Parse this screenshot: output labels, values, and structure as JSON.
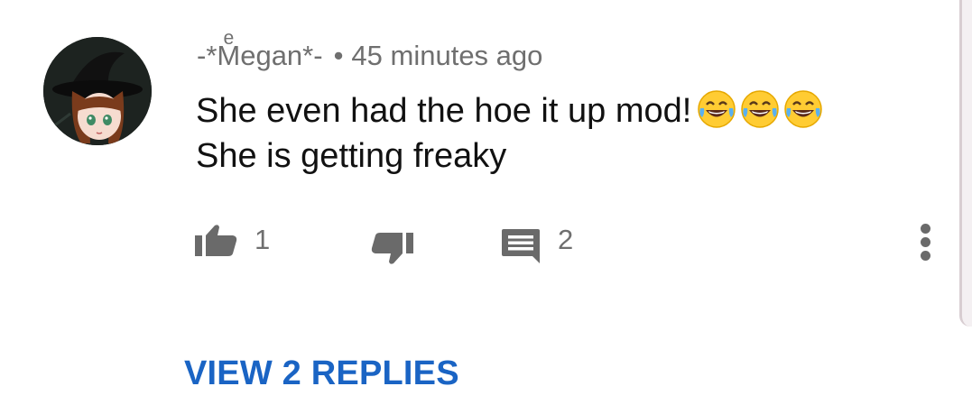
{
  "comment": {
    "author": "-*Mͤegan*-",
    "separator": "•",
    "timestamp": "45 minutes ago",
    "text_line_1": "She even had the hoe it up mod!",
    "text_line_2": "She is getting freaky",
    "emojis": [
      "face-with-tears-of-joy",
      "face-with-tears-of-joy",
      "face-with-tears-of-joy"
    ],
    "like_count": "1",
    "reply_count": "2",
    "view_replies_label": "VIEW 2 REPLIES"
  },
  "icons": {
    "like": "thumbs-up-icon",
    "dislike": "thumbs-down-icon",
    "reply": "comment-icon",
    "more": "more-vertical-icon"
  },
  "colors": {
    "link": "#1a64c4",
    "muted": "#6f6f6f",
    "text": "#111111"
  }
}
